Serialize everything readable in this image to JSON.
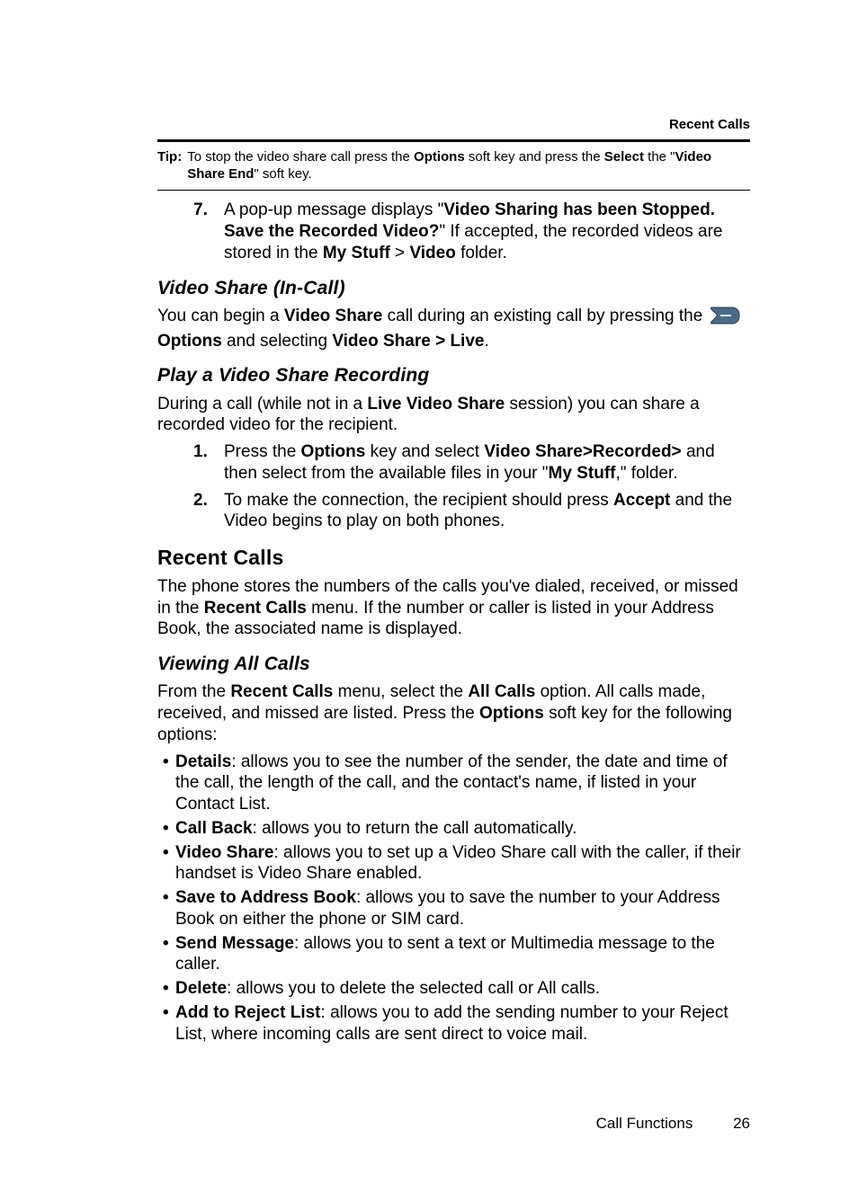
{
  "running_head": "Recent Calls",
  "tip": {
    "label": "Tip:",
    "pre": "To stop the video share call press the ",
    "b1": "Options",
    "mid1": " soft key and press the ",
    "b2": "Select",
    "mid2": " the \"",
    "b3": "Video Share End",
    "post": "\" soft key."
  },
  "step7": {
    "num": "7.",
    "pre": "A pop-up message displays \"",
    "b1": "Video Sharing has been Stopped. Save the Recorded Video?",
    "mid1": "\" If accepted, the recorded videos are stored in the ",
    "b2": "My Stuff",
    "mid2": " > ",
    "b3": "Video",
    "post": " folder."
  },
  "h_vsincall": "Video Share (In-Call)",
  "vsincall": {
    "pre": "You can begin a ",
    "b1": "Video Share",
    "mid1": " call during an existing call by pressing the ",
    "line2_b1": "Options",
    "line2_mid": " and selecting ",
    "line2_b2": "Video Share > Live",
    "line2_post": "."
  },
  "h_play": "Play a Video Share Recording",
  "play_intro": {
    "pre": "During a call (while not in a ",
    "b1": "Live Video Share",
    "post": " session) you can share a recorded video for the recipient."
  },
  "play_step1": {
    "num": "1.",
    "pre": "Press the ",
    "b1": "Options",
    "mid1": " key and select ",
    "b2": "Video Share>Recorded>",
    "mid2": "  and then select from the available files in your \"",
    "b3": "My Stuff",
    "post": ",\" folder."
  },
  "play_step2": {
    "num": "2.",
    "pre": "To make the connection, the recipient should press ",
    "b1": "Accept",
    "post": " and the Video begins to play on both phones."
  },
  "h_recent": "Recent Calls",
  "recent_intro": {
    "pre": "The phone stores the numbers of the calls you've dialed, received, or missed in the ",
    "b1": "Recent Calls",
    "post": " menu. If the number or caller is listed in your Address Book, the associated name is displayed."
  },
  "h_viewall": "Viewing All Calls",
  "viewall_intro": {
    "pre": "From the ",
    "b1": "Recent Calls",
    "mid1": " menu, select the ",
    "b2": "All Calls",
    "mid2": " option. All calls made, received, and missed are listed. Press the ",
    "b3": "Options",
    "post": " soft key for the following options:"
  },
  "bullets": [
    {
      "b": "Details",
      "t": ": allows you to see the number of the sender, the date and time of the call, the length of the call, and the contact's name, if listed in your Contact List."
    },
    {
      "b": "Call Back",
      "t": ": allows you to return the call automatically."
    },
    {
      "b": "Video Share",
      "t": ": allows you to set up a Video Share call with the caller, if their handset is Video Share enabled."
    },
    {
      "b": "Save to Address Book",
      "t": ": allows you to save the number to your Address Book on either the phone or SIM card."
    },
    {
      "b": "Send Message",
      "t": ": allows you to sent a text or Multimedia message to the caller."
    },
    {
      "b": "Delete",
      "t": ": allows you to delete the selected call or All calls."
    },
    {
      "b": "Add to Reject List",
      "t": ": allows you to add the sending number to your Reject List, where incoming calls are sent direct to voice mail."
    }
  ],
  "footer": {
    "section": "Call Functions",
    "page": "26"
  }
}
